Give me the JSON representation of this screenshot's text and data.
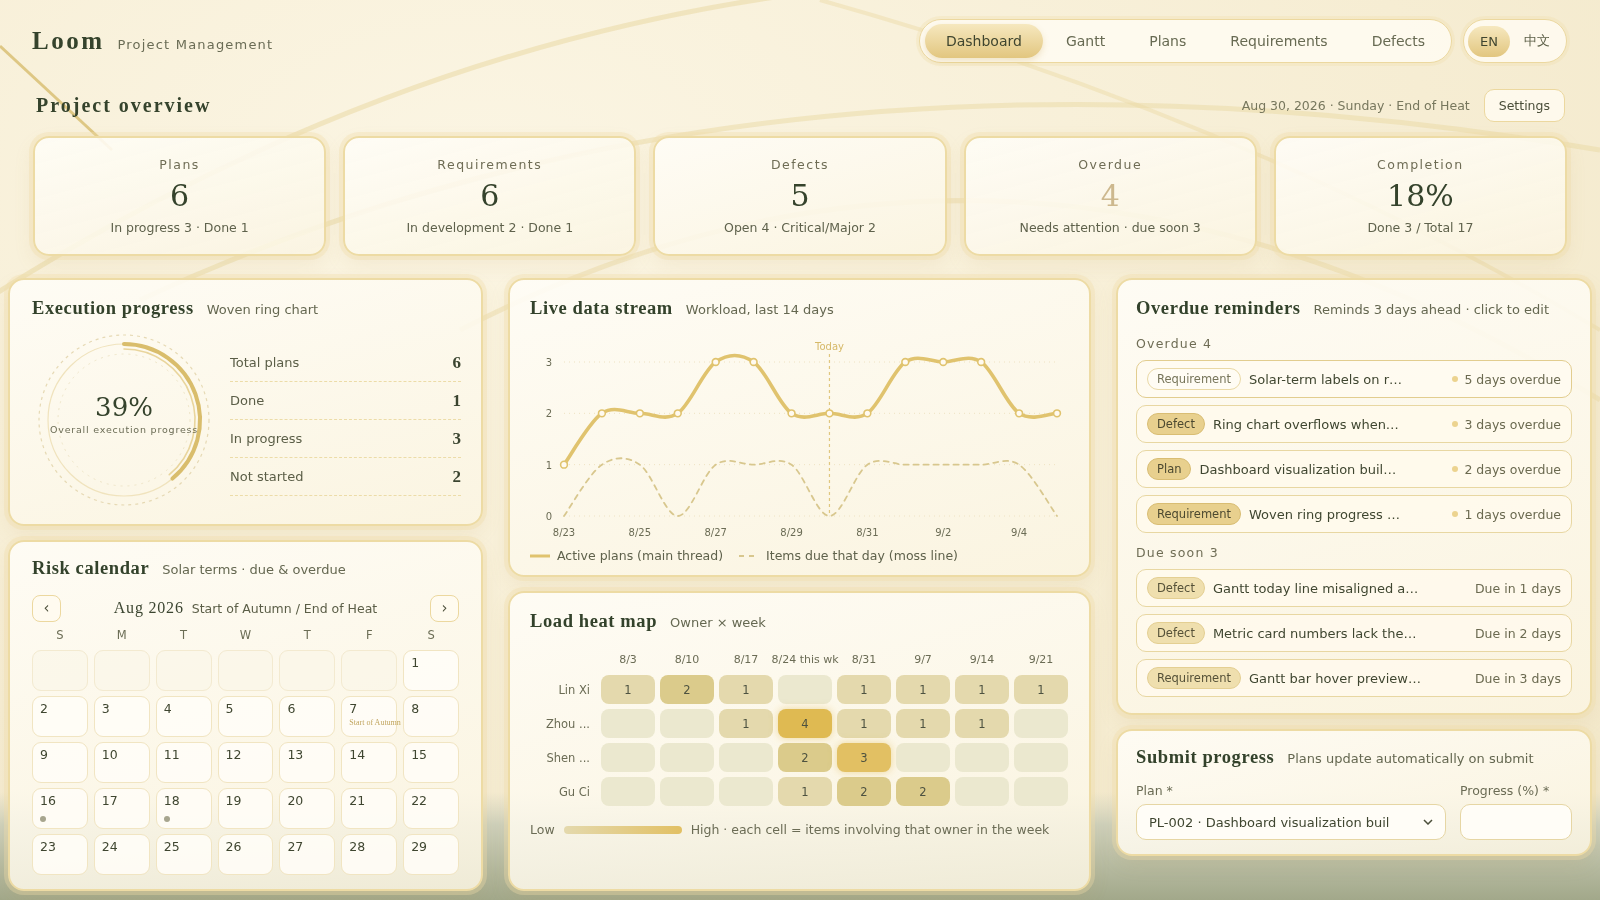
{
  "brand": {
    "name": "Loom",
    "tagline": "Project Management"
  },
  "nav": {
    "tabs": [
      {
        "label": "Dashboard",
        "selected": true
      },
      {
        "label": "Gantt",
        "selected": false
      },
      {
        "label": "Plans",
        "selected": false
      },
      {
        "label": "Requirements",
        "selected": false
      },
      {
        "label": "Defects",
        "selected": false
      }
    ],
    "languages": [
      {
        "label": "EN",
        "selected": true
      },
      {
        "label": "中文",
        "selected": false
      }
    ]
  },
  "overview": {
    "title": "Project overview",
    "date": "Aug 30, 2026 · Sunday · End of Heat",
    "settings_button": "Settings"
  },
  "metrics": [
    {
      "label": "Plans",
      "value": "6",
      "detail": "In progress 3 · Done 1",
      "kind": "normal"
    },
    {
      "label": "Requirements",
      "value": "6",
      "detail": "In development 2 · Done 1",
      "kind": "normal"
    },
    {
      "label": "Defects",
      "value": "5",
      "detail": "Open 4 · Critical/Major 2",
      "kind": "normal"
    },
    {
      "label": "Overdue",
      "value": "4",
      "detail": "Needs attention · due soon 3",
      "kind": "alert"
    },
    {
      "label": "Completion",
      "value": "18%",
      "detail": "Done 3 / Total 17",
      "kind": "normal"
    }
  ],
  "execution": {
    "title": "Execution progress",
    "subtitle": "Woven ring chart",
    "ring": {
      "value": "39%",
      "caption": "Overall execution progress"
    },
    "stats": [
      {
        "label": "Total plans",
        "value": "6"
      },
      {
        "label": "Done",
        "value": "1"
      },
      {
        "label": "In progress",
        "value": "3"
      },
      {
        "label": "Not started",
        "value": "2"
      }
    ]
  },
  "live_stream": {
    "title": "Live data stream",
    "subtitle": "Workload, last 14 days",
    "today_label": "Today",
    "chart_data": {
      "type": "line",
      "categories": [
        "8/23",
        null,
        "8/25",
        null,
        "8/27",
        null,
        "8/29",
        null,
        "8/31",
        null,
        "9/2",
        null,
        "9/4",
        null
      ],
      "ylim": [
        0,
        3
      ],
      "yticks": [
        0,
        1,
        2,
        3
      ],
      "legend": "bottom",
      "series": [
        {
          "name": "Active plans (main thread)",
          "color": "#e0c36e",
          "marker": "circle",
          "values": [
            1,
            2,
            2,
            2,
            3,
            3,
            2,
            2,
            2,
            3,
            3,
            3,
            2,
            2
          ]
        },
        {
          "name": "Items due that day (moss line)",
          "color": "#d8c78e",
          "line_style": "dashed",
          "values": [
            0,
            1,
            1,
            0,
            1,
            1,
            1,
            0,
            1,
            1,
            1,
            1,
            1,
            0
          ]
        }
      ]
    }
  },
  "risk_calendar": {
    "title": "Risk calendar",
    "subtitle": "Solar terms · due & overdue",
    "prev_button": "‹",
    "next_button": "›",
    "month": "Aug 2026",
    "terms": "Start of Autumn / End of Heat",
    "weekdays": [
      "S",
      "M",
      "T",
      "W",
      "T",
      "F",
      "S"
    ],
    "weeks": [
      [
        {
          "day": "1",
          "marked": false
        }
      ],
      [
        {
          "day": "2",
          "marked": false
        },
        {
          "day": "3",
          "marked": false
        },
        {
          "day": "4",
          "marked": false
        },
        {
          "day": "5",
          "marked": false
        },
        {
          "day": "6",
          "marked": false
        },
        {
          "day": "7",
          "term": "Start of Autumn",
          "marked": false
        },
        {
          "day": "8",
          "marked": false
        }
      ],
      [
        {
          "day": "9",
          "marked": false
        },
        {
          "day": "10",
          "marked": false
        },
        {
          "day": "11",
          "marked": false
        },
        {
          "day": "12",
          "marked": false
        },
        {
          "day": "13",
          "marked": false
        },
        {
          "day": "14",
          "marked": false
        },
        {
          "day": "15",
          "marked": false
        }
      ],
      [
        {
          "day": "16",
          "marked": true
        },
        {
          "day": "17",
          "marked": false
        },
        {
          "day": "18",
          "marked": true
        },
        {
          "day": "19",
          "marked": false
        },
        {
          "day": "20",
          "marked": false
        },
        {
          "day": "21",
          "marked": false
        },
        {
          "day": "22",
          "marked": false
        }
      ],
      [
        {
          "day": "23",
          "marked": false
        },
        {
          "day": "24",
          "marked": false
        },
        {
          "day": "25",
          "marked": false
        },
        {
          "day": "26",
          "marked": false
        },
        {
          "day": "27",
          "marked": false
        },
        {
          "day": "28",
          "marked": false
        },
        {
          "day": "29",
          "marked": false
        }
      ]
    ]
  },
  "heat_map": {
    "title": "Load heat map",
    "subtitle": "Owner × week",
    "weeks": [
      "8/3",
      "8/10",
      "8/17",
      "8/24 this wk",
      "8/31",
      "9/7",
      "9/14",
      "9/21"
    ],
    "rows": [
      {
        "owner": "Lin Xi",
        "cells": [
          "1",
          "2",
          "1",
          null,
          "1",
          "1",
          "1",
          "1"
        ]
      },
      {
        "owner": "Zhou ...",
        "cells": [
          null,
          null,
          "1",
          "4",
          "1",
          "1",
          "1",
          null
        ]
      },
      {
        "owner": "Shen ...",
        "cells": [
          null,
          null,
          null,
          "2",
          "3",
          null,
          null,
          null
        ]
      },
      {
        "owner": "Gu Ci",
        "cells": [
          null,
          null,
          null,
          "1",
          "2",
          "2",
          null,
          null
        ]
      }
    ],
    "legend_low": "Low",
    "legend_high": "High · each cell = items involving that owner in the week"
  },
  "reminders": {
    "title": "Overdue reminders",
    "subtitle": "Reminds 3 days ahead · click to edit",
    "sections": [
      {
        "kind": "overdue",
        "label": "Overdue 4",
        "items": [
          {
            "tag": "Requirement",
            "title": "Solar-term labels on r…",
            "status": "5 days overdue",
            "selected": true
          },
          {
            "tag": "Defect",
            "title": "Ring chart overflows when…",
            "status": "3 days overdue",
            "selected": false
          },
          {
            "tag": "Plan",
            "title": "Dashboard visualization buil…",
            "status": "2 days overdue",
            "selected": false
          },
          {
            "tag": "Requirement",
            "title": "Woven ring progress …",
            "status": "1 days overdue",
            "selected": false
          }
        ]
      },
      {
        "kind": "due_soon",
        "label": "Due soon 3",
        "items": [
          {
            "tag": "Defect",
            "title": "Gantt today line misaligned a…",
            "status": "Due in 1 days",
            "selected": false
          },
          {
            "tag": "Defect",
            "title": "Metric card numbers lack the…",
            "status": "Due in 2 days",
            "selected": false
          },
          {
            "tag": "Requirement",
            "title": "Gantt bar hover preview…",
            "status": "Due in 3 days",
            "selected": false
          }
        ]
      }
    ]
  },
  "submit": {
    "title": "Submit progress",
    "subtitle": "Plans update automatically on submit",
    "plan_label": "Plan *",
    "plan_value": "PL-002 · Dashboard visualization buil",
    "progress_label": "Progress (%) *"
  }
}
